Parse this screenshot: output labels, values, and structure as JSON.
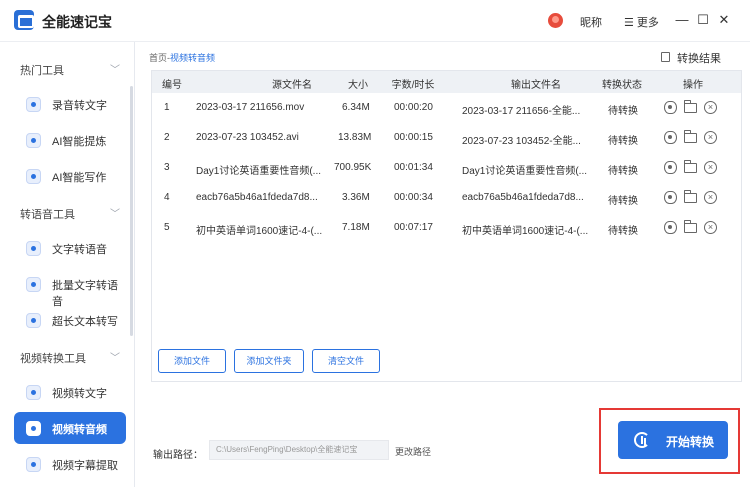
{
  "window": {
    "title": "全能速记宝",
    "nickname": "昵称",
    "more": "☰ 更多",
    "min": "—",
    "max": "☐",
    "close": "✕"
  },
  "sidebar": {
    "groups": [
      {
        "label": "热门工具",
        "items": [
          "录音转文字",
          "AI智能提炼",
          "AI智能写作"
        ]
      },
      {
        "label": "转语音工具",
        "items": [
          "文字转语音",
          "批量文字转语音",
          "超长文本转写"
        ]
      },
      {
        "label": "视频转换工具",
        "items": [
          "视频转文字",
          "视频转音频",
          "视频字幕提取"
        ]
      }
    ],
    "active_item": "视频转音频"
  },
  "breadcrumb": {
    "home": "首页",
    "sep": "-",
    "current": "视频转音频"
  },
  "result_link": "转换结果",
  "table": {
    "headers": [
      "编号",
      "源文件名",
      "大小",
      "字数/时长",
      "输出文件名",
      "转换状态",
      "操作"
    ],
    "rows": [
      {
        "no": "1",
        "src": "2023-03-17 211656.mov",
        "size": "6.34M",
        "duration": "00:00:20",
        "out": "2023-03-17 211656-全能...",
        "status": "待转换"
      },
      {
        "no": "2",
        "src": "2023-07-23 103452.avi",
        "size": "13.83M",
        "duration": "00:00:15",
        "out": "2023-07-23 103452-全能...",
        "status": "待转换"
      },
      {
        "no": "3",
        "src": "Day1讨论英语重要性音频(...",
        "size": "700.95K",
        "duration": "00:01:34",
        "out": "Day1讨论英语重要性音频(...",
        "status": "待转换"
      },
      {
        "no": "4",
        "src": "eacb76a5b46a1fdeda7d8...",
        "size": "3.36M",
        "duration": "00:00:34",
        "out": "eacb76a5b46a1fdeda7d8...",
        "status": "待转换"
      },
      {
        "no": "5",
        "src": "初中英语单词1600速记-4-(...",
        "size": "7.18M",
        "duration": "00:07:17",
        "out": "初中英语单词1600速记-4-(...",
        "status": "待转换"
      }
    ]
  },
  "buttons": {
    "add_file": "添加文件",
    "add_folder": "添加文件夹",
    "clear": "清空文件",
    "start": "开始转换"
  },
  "output": {
    "label": "输出路径：",
    "path": "C:\\Users\\FengPing\\Desktop\\全能速记宝",
    "change": "更改路径"
  },
  "colors": {
    "accent": "#2b72e0",
    "highlight": "#e53935"
  }
}
